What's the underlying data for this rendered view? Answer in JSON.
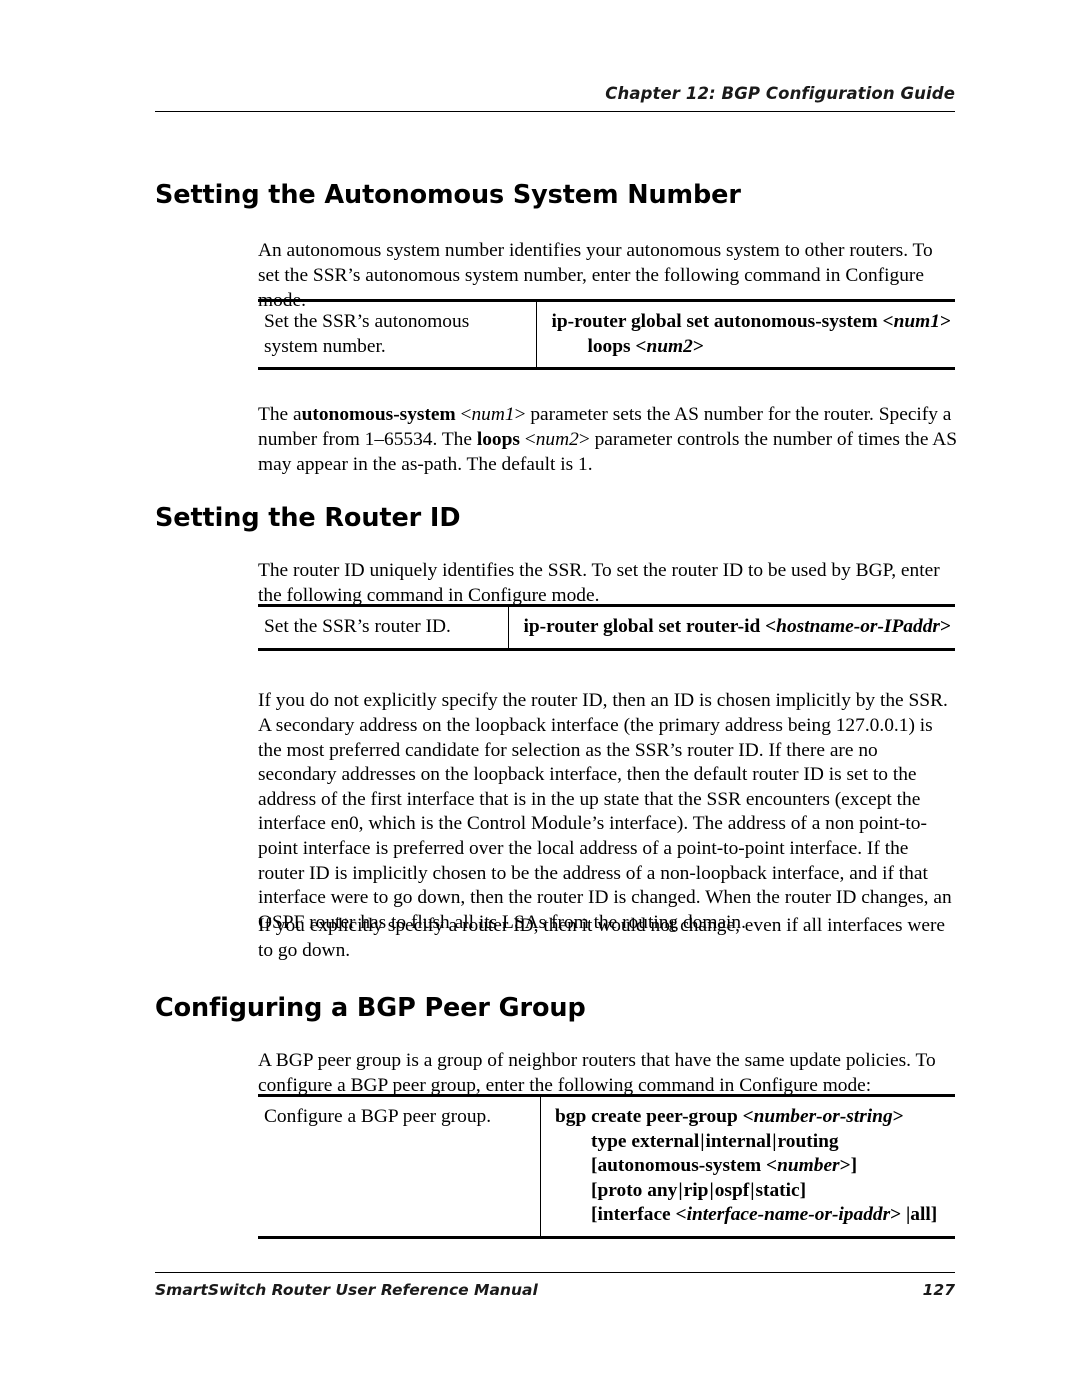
{
  "header": {
    "chapter": "Chapter 12: BGP Configuration Guide"
  },
  "sections": [
    {
      "heading": "Setting the Autonomous System Number",
      "intro": "An autonomous system number identifies your autonomous system to other routers. To set the SSR’s autonomous system number, enter the following command in Configure mode."
    },
    {
      "heading": "Setting the Router ID",
      "intro": "The router ID uniquely identifies the SSR. To set the router ID to be used by BGP, enter the following command in Configure mode."
    },
    {
      "heading": "Configuring a BGP Peer Group",
      "intro": "A BGP peer group is a group of neighbor routers that have the same update policies. To configure a BGP peer group, enter the following command in Configure mode:"
    }
  ],
  "tables": {
    "autonomous_system": {
      "description": "Set the SSR’s autonomous system number.",
      "command_lines": [
        "ip-router global set autonomous-system <num1>",
        "loops <num2>"
      ]
    },
    "router_id": {
      "description": "Set the SSR’s router ID.",
      "command_lines": [
        "ip-router global set router-id <hostname-or-IPaddr>"
      ]
    },
    "peer_group": {
      "description": "Configure a BGP peer group.",
      "command_lines": [
        "bgp create peer-group <number-or-string>",
        "type external | internal | routing",
        "[autonomous-system <number>]",
        "[proto any | rip | ospf | static]",
        "[interface <interface-name-or-ipaddr> | all]"
      ]
    }
  },
  "paragraphs": {
    "as_description": "The autonomous-system <num1> parameter sets the AS number for the router. Specify a number from 1–65534. The loops <num2> parameter controls the number of times the AS may appear in the as-path. The default is 1.",
    "router_id_long": "If you do not explicitly specify the router ID, then an ID is chosen implicitly by the SSR. A secondary address on the loopback interface (the primary address being 127.0.0.1) is the most preferred candidate for selection as the SSR’s router ID. If there are no secondary addresses on the loopback interface, then the default router ID is set to the address of the first interface that is in the up state that the SSR encounters (except the interface en0, which is the Control Module’s interface). The address of a non point-to-point interface is preferred over the local address of a point-to-point interface. If the router ID is implicitly chosen to be the address of a non-loopback interface, and if that interface were to go down, then the router ID is changed. When the router ID changes, an OSPF router has to flush all its LSAs from the routing domain.",
    "router_id_explicit": "If you explicitly specify a router ID, then it would not change, even if all interfaces were to go down."
  },
  "footer": {
    "manual_title": "SmartSwitch Router User Reference Manual",
    "page_number": "127"
  }
}
